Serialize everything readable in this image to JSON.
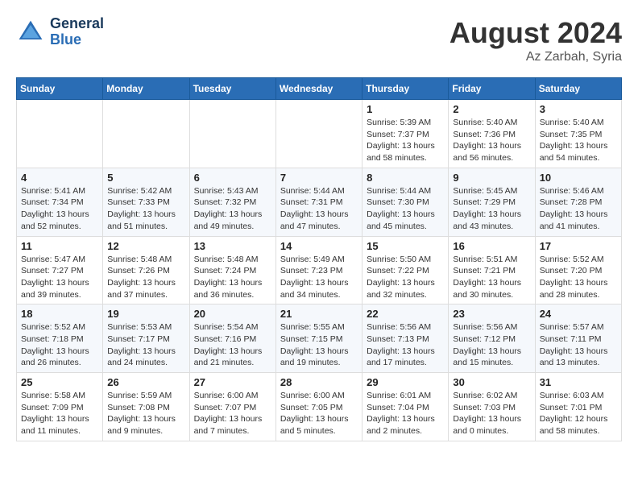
{
  "header": {
    "logo_line1": "General",
    "logo_line2": "Blue",
    "month_title": "August 2024",
    "location": "Az Zarbah, Syria"
  },
  "weekdays": [
    "Sunday",
    "Monday",
    "Tuesday",
    "Wednesday",
    "Thursday",
    "Friday",
    "Saturday"
  ],
  "weeks": [
    [
      {
        "day": "",
        "info": ""
      },
      {
        "day": "",
        "info": ""
      },
      {
        "day": "",
        "info": ""
      },
      {
        "day": "",
        "info": ""
      },
      {
        "day": "1",
        "info": "Sunrise: 5:39 AM\nSunset: 7:37 PM\nDaylight: 13 hours\nand 58 minutes."
      },
      {
        "day": "2",
        "info": "Sunrise: 5:40 AM\nSunset: 7:36 PM\nDaylight: 13 hours\nand 56 minutes."
      },
      {
        "day": "3",
        "info": "Sunrise: 5:40 AM\nSunset: 7:35 PM\nDaylight: 13 hours\nand 54 minutes."
      }
    ],
    [
      {
        "day": "4",
        "info": "Sunrise: 5:41 AM\nSunset: 7:34 PM\nDaylight: 13 hours\nand 52 minutes."
      },
      {
        "day": "5",
        "info": "Sunrise: 5:42 AM\nSunset: 7:33 PM\nDaylight: 13 hours\nand 51 minutes."
      },
      {
        "day": "6",
        "info": "Sunrise: 5:43 AM\nSunset: 7:32 PM\nDaylight: 13 hours\nand 49 minutes."
      },
      {
        "day": "7",
        "info": "Sunrise: 5:44 AM\nSunset: 7:31 PM\nDaylight: 13 hours\nand 47 minutes."
      },
      {
        "day": "8",
        "info": "Sunrise: 5:44 AM\nSunset: 7:30 PM\nDaylight: 13 hours\nand 45 minutes."
      },
      {
        "day": "9",
        "info": "Sunrise: 5:45 AM\nSunset: 7:29 PM\nDaylight: 13 hours\nand 43 minutes."
      },
      {
        "day": "10",
        "info": "Sunrise: 5:46 AM\nSunset: 7:28 PM\nDaylight: 13 hours\nand 41 minutes."
      }
    ],
    [
      {
        "day": "11",
        "info": "Sunrise: 5:47 AM\nSunset: 7:27 PM\nDaylight: 13 hours\nand 39 minutes."
      },
      {
        "day": "12",
        "info": "Sunrise: 5:48 AM\nSunset: 7:26 PM\nDaylight: 13 hours\nand 37 minutes."
      },
      {
        "day": "13",
        "info": "Sunrise: 5:48 AM\nSunset: 7:24 PM\nDaylight: 13 hours\nand 36 minutes."
      },
      {
        "day": "14",
        "info": "Sunrise: 5:49 AM\nSunset: 7:23 PM\nDaylight: 13 hours\nand 34 minutes."
      },
      {
        "day": "15",
        "info": "Sunrise: 5:50 AM\nSunset: 7:22 PM\nDaylight: 13 hours\nand 32 minutes."
      },
      {
        "day": "16",
        "info": "Sunrise: 5:51 AM\nSunset: 7:21 PM\nDaylight: 13 hours\nand 30 minutes."
      },
      {
        "day": "17",
        "info": "Sunrise: 5:52 AM\nSunset: 7:20 PM\nDaylight: 13 hours\nand 28 minutes."
      }
    ],
    [
      {
        "day": "18",
        "info": "Sunrise: 5:52 AM\nSunset: 7:18 PM\nDaylight: 13 hours\nand 26 minutes."
      },
      {
        "day": "19",
        "info": "Sunrise: 5:53 AM\nSunset: 7:17 PM\nDaylight: 13 hours\nand 24 minutes."
      },
      {
        "day": "20",
        "info": "Sunrise: 5:54 AM\nSunset: 7:16 PM\nDaylight: 13 hours\nand 21 minutes."
      },
      {
        "day": "21",
        "info": "Sunrise: 5:55 AM\nSunset: 7:15 PM\nDaylight: 13 hours\nand 19 minutes."
      },
      {
        "day": "22",
        "info": "Sunrise: 5:56 AM\nSunset: 7:13 PM\nDaylight: 13 hours\nand 17 minutes."
      },
      {
        "day": "23",
        "info": "Sunrise: 5:56 AM\nSunset: 7:12 PM\nDaylight: 13 hours\nand 15 minutes."
      },
      {
        "day": "24",
        "info": "Sunrise: 5:57 AM\nSunset: 7:11 PM\nDaylight: 13 hours\nand 13 minutes."
      }
    ],
    [
      {
        "day": "25",
        "info": "Sunrise: 5:58 AM\nSunset: 7:09 PM\nDaylight: 13 hours\nand 11 minutes."
      },
      {
        "day": "26",
        "info": "Sunrise: 5:59 AM\nSunset: 7:08 PM\nDaylight: 13 hours\nand 9 minutes."
      },
      {
        "day": "27",
        "info": "Sunrise: 6:00 AM\nSunset: 7:07 PM\nDaylight: 13 hours\nand 7 minutes."
      },
      {
        "day": "28",
        "info": "Sunrise: 6:00 AM\nSunset: 7:05 PM\nDaylight: 13 hours\nand 5 minutes."
      },
      {
        "day": "29",
        "info": "Sunrise: 6:01 AM\nSunset: 7:04 PM\nDaylight: 13 hours\nand 2 minutes."
      },
      {
        "day": "30",
        "info": "Sunrise: 6:02 AM\nSunset: 7:03 PM\nDaylight: 13 hours\nand 0 minutes."
      },
      {
        "day": "31",
        "info": "Sunrise: 6:03 AM\nSunset: 7:01 PM\nDaylight: 12 hours\nand 58 minutes."
      }
    ]
  ]
}
